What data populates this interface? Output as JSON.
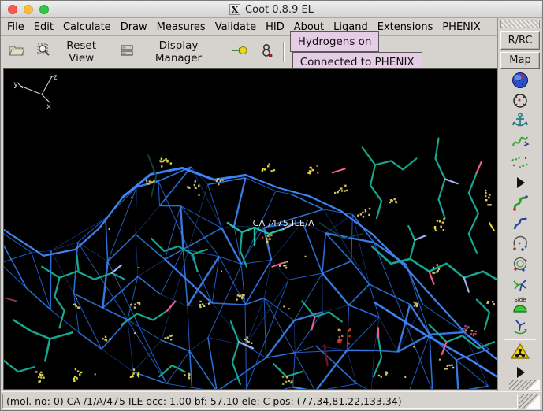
{
  "window": {
    "title": "Coot 0.8.9 EL",
    "icon": "x11-logo-icon",
    "traffic_lights": [
      "close-button",
      "minimize-button",
      "zoom-button"
    ]
  },
  "menu_bar": {
    "items": [
      {
        "label": "File",
        "mnemonic": "F"
      },
      {
        "label": "Edit",
        "mnemonic": "E"
      },
      {
        "label": "Calculate",
        "mnemonic": "C"
      },
      {
        "label": "Draw",
        "mnemonic": "D"
      },
      {
        "label": "Measures",
        "mnemonic": "M"
      },
      {
        "label": "Validate",
        "mnemonic": "V"
      },
      {
        "label": "HID",
        "mnemonic": ""
      },
      {
        "label": "About",
        "mnemonic": ""
      },
      {
        "label": "Ligand",
        "mnemonic": ""
      },
      {
        "label": "Extensions",
        "mnemonic": "x"
      },
      {
        "label": "PHENIX",
        "mnemonic": ""
      }
    ]
  },
  "toolbar": {
    "reset_view_label": "Reset View",
    "display_manager_label": "Display Manager",
    "icons": [
      "open-folder-icon",
      "reset-view-icon",
      "display-manager-icon",
      "go-to-atom-icon",
      "go-to-ligand-icon"
    ],
    "toggles": [
      {
        "label": "Hydrogens on"
      },
      {
        "label": "Connected to PHENIX"
      }
    ]
  },
  "sidebar": {
    "rrc_label": "R/RC",
    "map_label": "Map",
    "slide_label": "Side",
    "icons": [
      "sphere-refine-icon",
      "target-circle-icon",
      "anchor-icon",
      "real-space-refine-zone-icon",
      "regularize-zone-icon",
      "expand-more-icon",
      "auto-fit-rotamer-icon",
      "rotamer-icon",
      "edit-chi-angles-icon",
      "torsion-general-icon",
      "flip-peptide-icon",
      "side-chain-slide-icon",
      "side-chain-flip-icon",
      "separator",
      "hazard-icon",
      "spacer",
      "expand-more-icon"
    ]
  },
  "canvas": {
    "atom_label": "CA /475 ILE/A",
    "axes": {
      "x": "x",
      "y": "y",
      "z": "z"
    }
  },
  "status_bar": {
    "text": "(mol. no: 0)  CA /1/A/475 ILE occ:  1.00 bf: 57.10 ele:  C pos: (77.34,81.22,133.34)"
  },
  "colors": {
    "toggle_pink": "#e6cde6",
    "mesh_blue": "#2565d6",
    "mesh_blue_dim": "#1c4096",
    "mesh_blue_mid": "#2f7ae8",
    "mesh_blue_bright": "#3f84f4",
    "stick_teal": "#17a68e",
    "stick_teal_bright": "#27bfa6",
    "tip_pink": "#ef5a90",
    "tip_periwinkle": "#9fb2ea",
    "dark_red": "#6e1030",
    "dim_teal": "#0c4038",
    "dots_khaki": "#cfc06e",
    "dots_yellow": "#e3de34",
    "dots_orange": "#d4722c",
    "dots_red": "#c23326",
    "dots_purple": "#8c4a80",
    "canvas_bg": "#000000",
    "chrome": "#d6d3ce",
    "axes_green": "#cfe0cf"
  }
}
